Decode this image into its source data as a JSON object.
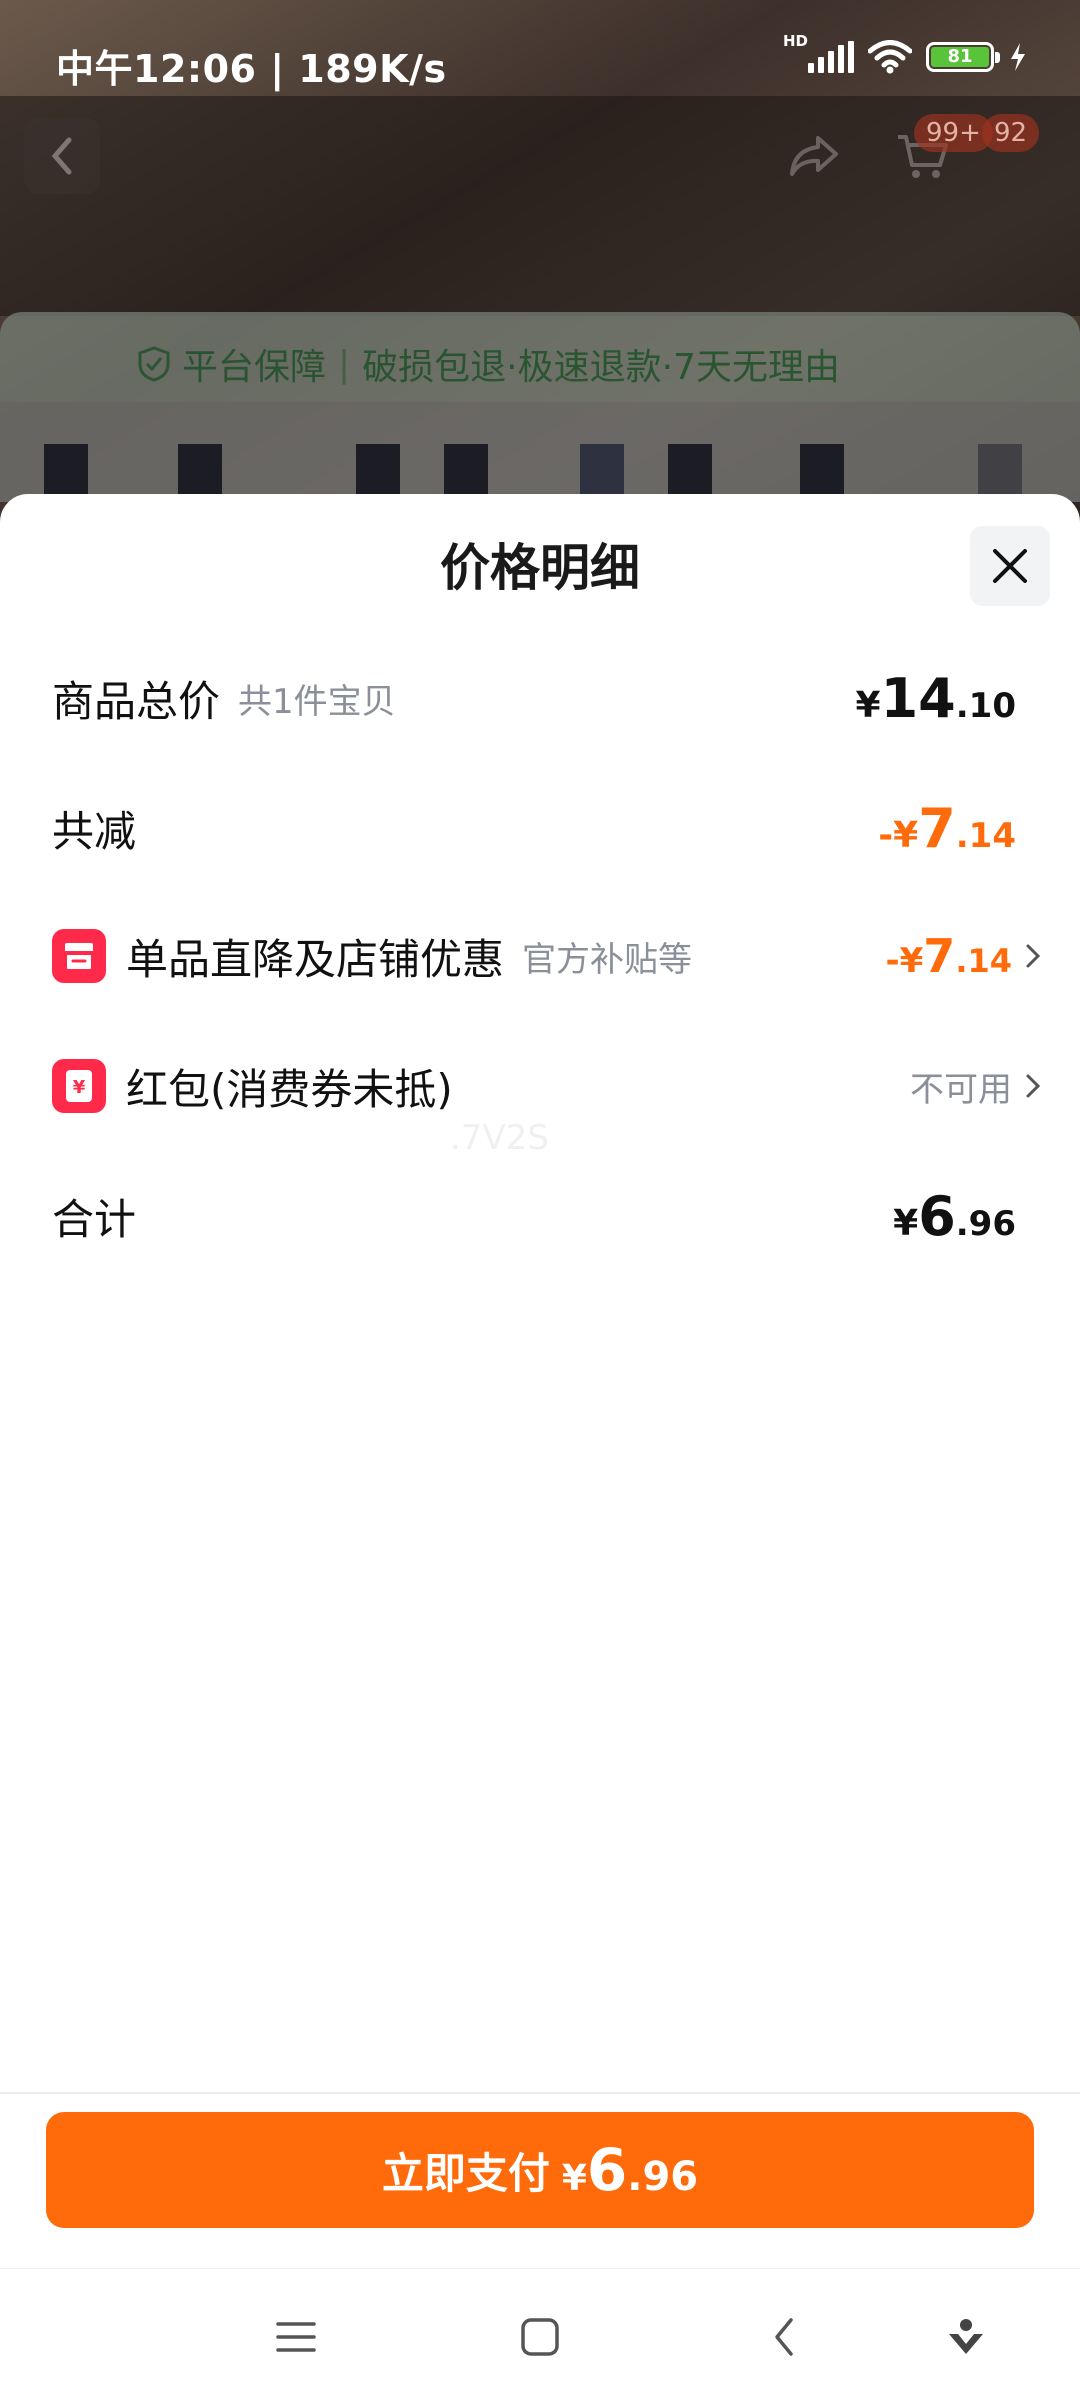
{
  "status_bar": {
    "time": "中午12:06 | 189K/s",
    "network_badge": "HD",
    "battery": "81"
  },
  "background_page": {
    "badge_cart": "99+",
    "badge_more": "92",
    "guarantee_title": "平台保障",
    "guarantee_items": "破损包退·极速退款·7天无理由"
  },
  "sheet": {
    "title": "价格明细",
    "rows": [
      {
        "label": "商品总价",
        "sub": "共1件宝贝",
        "symbol": "¥",
        "int": "14",
        "dec": ".10"
      },
      {
        "label": "共减",
        "symbol": "-¥",
        "int": "7",
        "dec": ".14"
      },
      {
        "label": "单品直降及店铺优惠",
        "sub": "官方补贴等",
        "symbol": "-¥",
        "int": "7",
        "dec": ".14",
        "icon": "store-icon"
      },
      {
        "label": "红包(消费券未抵)",
        "status": "不可用",
        "icon": "red-packet-icon"
      },
      {
        "label": "合计",
        "symbol": "¥",
        "int": "6",
        "dec": ".96"
      }
    ],
    "watermark": ".7V2S"
  },
  "pay_button": {
    "label": "立即支付",
    "symbol": "¥",
    "int": "6",
    "dec": ".96"
  },
  "colors": {
    "accent": "#ff6a0a",
    "coupon_red": "#ff2a4a"
  }
}
